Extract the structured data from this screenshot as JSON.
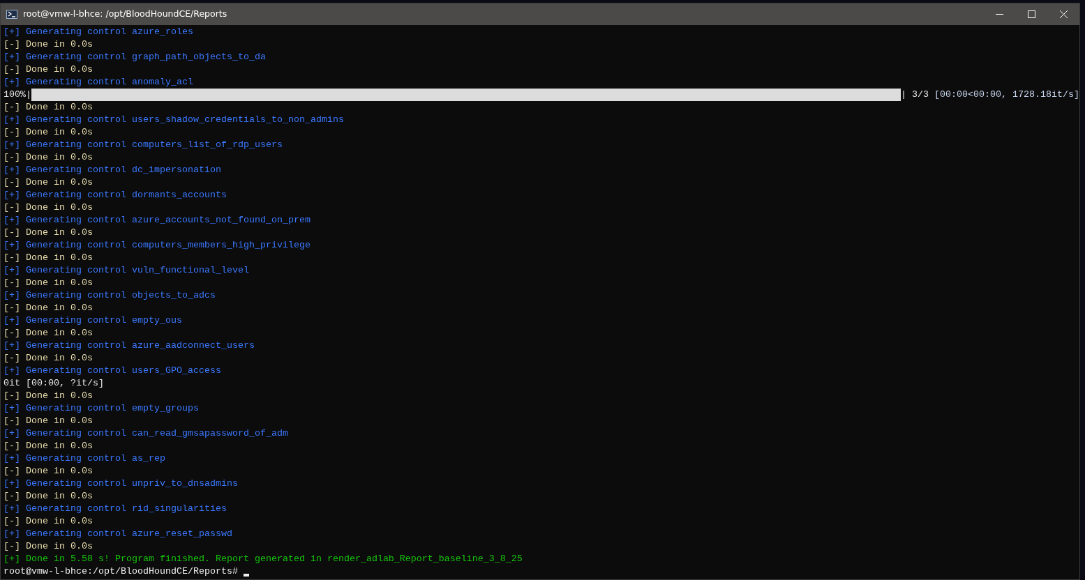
{
  "window": {
    "title": "root@vmw-l-bhce: /opt/BloodHoundCE/Reports"
  },
  "lines": [
    {
      "kind": "gen",
      "text": "[+] Generating control azure_roles"
    },
    {
      "kind": "done",
      "text": "[-] Done in 0.0s"
    },
    {
      "kind": "gen",
      "text": "[+] Generating control graph_path_objects_to_da"
    },
    {
      "kind": "done",
      "text": "[-] Done in 0.0s"
    },
    {
      "kind": "gen",
      "text": "[+] Generating control anomaly_acl"
    },
    {
      "kind": "progress",
      "left": "100%|",
      "level": 1,
      "right": "| 3/3",
      "stats": "[00:00<00:00, 1728.18it/s]"
    },
    {
      "kind": "done",
      "text": "[-] Done in 0.0s"
    },
    {
      "kind": "gen",
      "text": "[+] Generating control users_shadow_credentials_to_non_admins"
    },
    {
      "kind": "done",
      "text": "[-] Done in 0.0s"
    },
    {
      "kind": "gen",
      "text": "[+] Generating control computers_list_of_rdp_users"
    },
    {
      "kind": "done",
      "text": "[-] Done in 0.0s"
    },
    {
      "kind": "gen",
      "text": "[+] Generating control dc_impersonation"
    },
    {
      "kind": "done",
      "text": "[-] Done in 0.0s"
    },
    {
      "kind": "gen",
      "text": "[+] Generating control dormants_accounts"
    },
    {
      "kind": "done",
      "text": "[-] Done in 0.0s"
    },
    {
      "kind": "gen",
      "text": "[+] Generating control azure_accounts_not_found_on_prem"
    },
    {
      "kind": "done",
      "text": "[-] Done in 0.0s"
    },
    {
      "kind": "gen",
      "text": "[+] Generating control computers_members_high_privilege"
    },
    {
      "kind": "done",
      "text": "[-] Done in 0.0s"
    },
    {
      "kind": "gen",
      "text": "[+] Generating control vuln_functional_level"
    },
    {
      "kind": "done",
      "text": "[-] Done in 0.0s"
    },
    {
      "kind": "gen",
      "text": "[+] Generating control objects_to_adcs"
    },
    {
      "kind": "done",
      "text": "[-] Done in 0.0s"
    },
    {
      "kind": "gen",
      "text": "[+] Generating control empty_ous"
    },
    {
      "kind": "done",
      "text": "[-] Done in 0.0s"
    },
    {
      "kind": "gen",
      "text": "[+] Generating control azure_aadconnect_users"
    },
    {
      "kind": "done",
      "text": "[-] Done in 0.0s"
    },
    {
      "kind": "gen",
      "text": "[+] Generating control users_GPO_access"
    },
    {
      "kind": "plain",
      "text": "0it [00:00, ?it/s]"
    },
    {
      "kind": "done",
      "text": "[-] Done in 0.0s"
    },
    {
      "kind": "gen",
      "text": "[+] Generating control empty_groups"
    },
    {
      "kind": "done",
      "text": "[-] Done in 0.0s"
    },
    {
      "kind": "gen",
      "text": "[+] Generating control can_read_gmsapassword_of_adm"
    },
    {
      "kind": "done",
      "text": "[-] Done in 0.0s"
    },
    {
      "kind": "gen",
      "text": "[+] Generating control as_rep"
    },
    {
      "kind": "done",
      "text": "[-] Done in 0.0s"
    },
    {
      "kind": "gen",
      "text": "[+] Generating control unpriv_to_dnsadmins"
    },
    {
      "kind": "done",
      "text": "[-] Done in 0.0s"
    },
    {
      "kind": "gen",
      "text": "[+] Generating control rid_singularities"
    },
    {
      "kind": "done",
      "text": "[-] Done in 0.0s"
    },
    {
      "kind": "gen",
      "text": "[+] Generating control azure_reset_passwd"
    },
    {
      "kind": "done",
      "text": "[-] Done in 0.0s"
    },
    {
      "kind": "success",
      "text": "[+] Done in 5.58 s! Program finished. Report generated in render_adlab_Report_baseline_3_8_25"
    },
    {
      "kind": "prompt",
      "text": "root@vmw-l-bhce:/opt/BloodHoundCE/Reports#"
    }
  ]
}
